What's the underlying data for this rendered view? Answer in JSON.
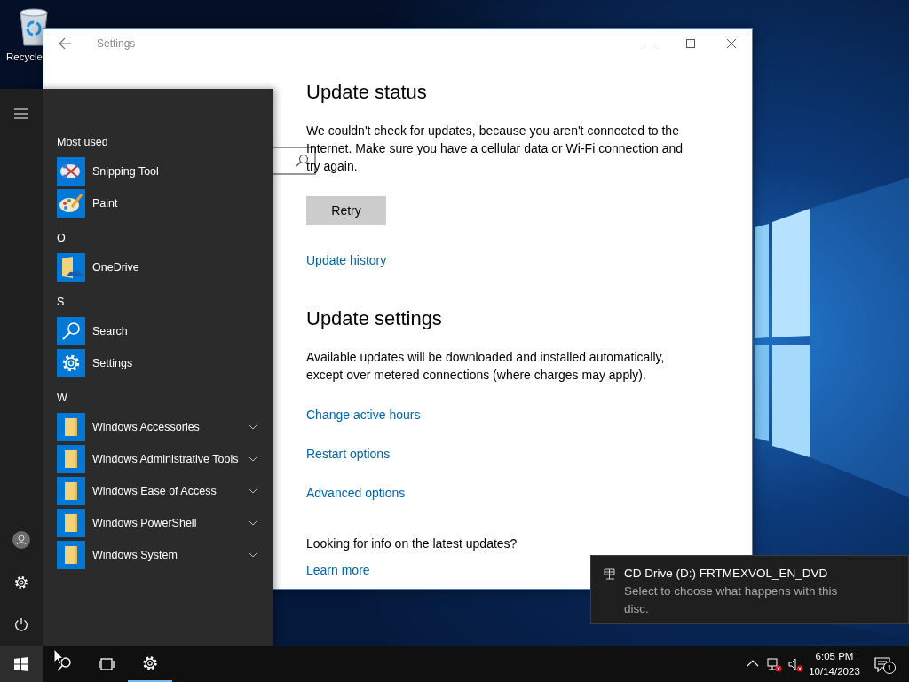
{
  "desktop": {
    "icons": [
      {
        "label": "Recycle"
      }
    ]
  },
  "settings_window": {
    "title": "Settings",
    "sections": [
      {
        "heading": "Update status",
        "paragraph": "We couldn't check for updates, because you aren't connected to the Internet. Make sure you have a cellular data or Wi-Fi connection and try again.",
        "button": "Retry",
        "links": [
          "Update history"
        ]
      },
      {
        "heading": "Update settings",
        "paragraph": "Available updates will be downloaded and installed automatically, except over metered connections (where charges may apply).",
        "links": [
          "Change active hours",
          "Restart options",
          "Advanced options"
        ]
      }
    ],
    "info": {
      "question": "Looking for info on the latest updates?",
      "link": "Learn more"
    }
  },
  "start_menu": {
    "groups": [
      {
        "header": "Most used",
        "apps": [
          {
            "name": "Snipping Tool",
            "kind": "snipping"
          },
          {
            "name": "Paint",
            "kind": "paint"
          }
        ]
      },
      {
        "header": "O",
        "apps": [
          {
            "name": "OneDrive",
            "kind": "onedrive"
          }
        ]
      },
      {
        "header": "S",
        "apps": [
          {
            "name": "Search",
            "kind": "search"
          },
          {
            "name": "Settings",
            "kind": "settings"
          }
        ]
      },
      {
        "header": "W",
        "apps": [
          {
            "name": "Windows Accessories",
            "kind": "folder"
          },
          {
            "name": "Windows Administrative Tools",
            "kind": "folder"
          },
          {
            "name": "Windows Ease of Access",
            "kind": "folder"
          },
          {
            "name": "Windows PowerShell",
            "kind": "folder"
          },
          {
            "name": "Windows System",
            "kind": "folder"
          }
        ]
      }
    ]
  },
  "taskbar": {
    "start_selected": true,
    "apps": [
      {
        "kind": "search",
        "running": false
      },
      {
        "kind": "task-view",
        "running": false
      },
      {
        "kind": "settings",
        "running": true
      }
    ],
    "clock": {
      "time": "6:05 PM",
      "date": "10/14/2023"
    },
    "notification_count": "1"
  },
  "toast": {
    "title": "CD Drive (D:) FRTMEXVOL_EN_DVD",
    "body": "Select to choose what happens with this disc."
  }
}
